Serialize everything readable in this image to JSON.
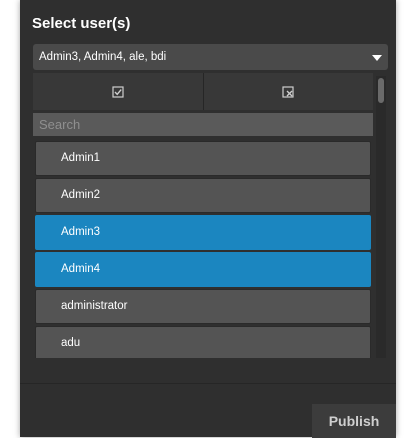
{
  "dialog": {
    "title": "Select user(s)",
    "selected_summary": "Admin3, Admin4, ale, bdi"
  },
  "toolbar": {
    "select_all_icon": "select-all-icon",
    "deselect_all_icon": "deselect-all-icon"
  },
  "search": {
    "placeholder": "Search",
    "value": ""
  },
  "users": [
    {
      "label": "Admin1",
      "selected": false
    },
    {
      "label": "Admin2",
      "selected": false
    },
    {
      "label": "Admin3",
      "selected": true
    },
    {
      "label": "Admin4",
      "selected": true
    },
    {
      "label": "administrator",
      "selected": false
    },
    {
      "label": "adu",
      "selected": false
    }
  ],
  "footer": {
    "publish_label": "Publish"
  },
  "colors": {
    "panel_bg": "#2f2f2f",
    "item_bg": "#545454",
    "selected_bg": "#1b86c0",
    "text": "#ffffff"
  }
}
